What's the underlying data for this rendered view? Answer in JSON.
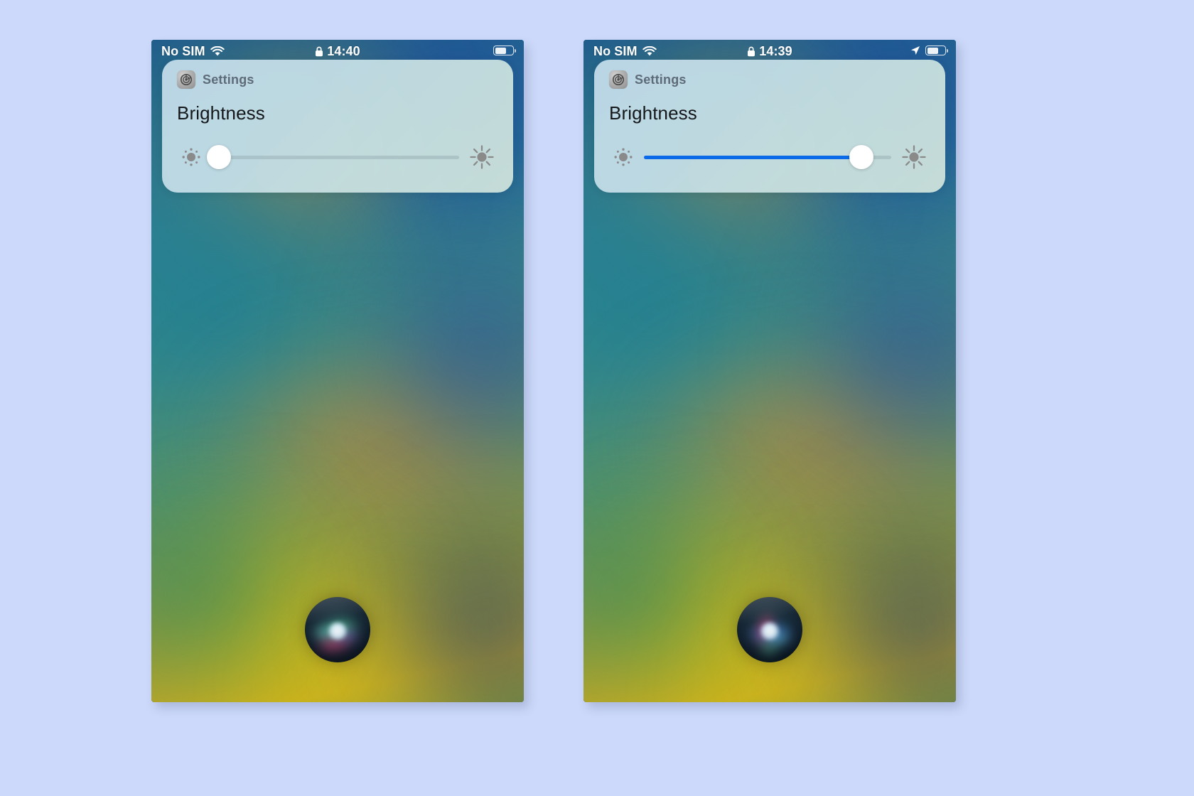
{
  "page": {
    "background_color": "#ccd9fa",
    "title": "iOS brightness slider — before and after"
  },
  "phones": [
    {
      "id": "phone-left",
      "status_bar": {
        "carrier": "No SIM",
        "wifi_icon": "wifi-icon",
        "lock_icon": "lock-icon",
        "time": "14:40",
        "battery_icon": "battery-icon",
        "battery_level_percent": 58
      },
      "banner": {
        "app_icon": "settings-gear-icon",
        "app_name": "Settings",
        "title": "Brightness",
        "slider": {
          "min_icon": "brightness-low-icon",
          "max_icon": "brightness-high-icon",
          "value_percent": 3,
          "fill_color": "#0a6ae8",
          "track_color": "rgba(130,148,158,0.32)",
          "knob_color": "#ffffff"
        }
      },
      "siri_orb": {
        "icon": "siri-orb-icon",
        "colors": [
          "#60e0a8",
          "#78e1dc",
          "#f04682",
          "#af82fa"
        ]
      }
    },
    {
      "id": "phone-right",
      "status_bar": {
        "carrier": "No SIM",
        "wifi_icon": "wifi-icon",
        "lock_icon": "lock-icon",
        "time": "14:39",
        "location_icon": "location-arrow-icon",
        "battery_icon": "battery-icon",
        "battery_level_percent": 58
      },
      "banner": {
        "app_icon": "settings-gear-icon",
        "app_name": "Settings",
        "title": "Brightness",
        "slider": {
          "min_icon": "brightness-low-icon",
          "max_icon": "brightness-high-icon",
          "value_percent": 88,
          "fill_color": "#0a6ae8",
          "track_color": "rgba(130,148,158,0.32)",
          "knob_color": "#ffffff"
        }
      },
      "siri_orb": {
        "icon": "siri-orb-icon",
        "colors": [
          "#4096ff",
          "#f53c6e",
          "#78d7ff",
          "#6ed7a5"
        ]
      }
    }
  ]
}
